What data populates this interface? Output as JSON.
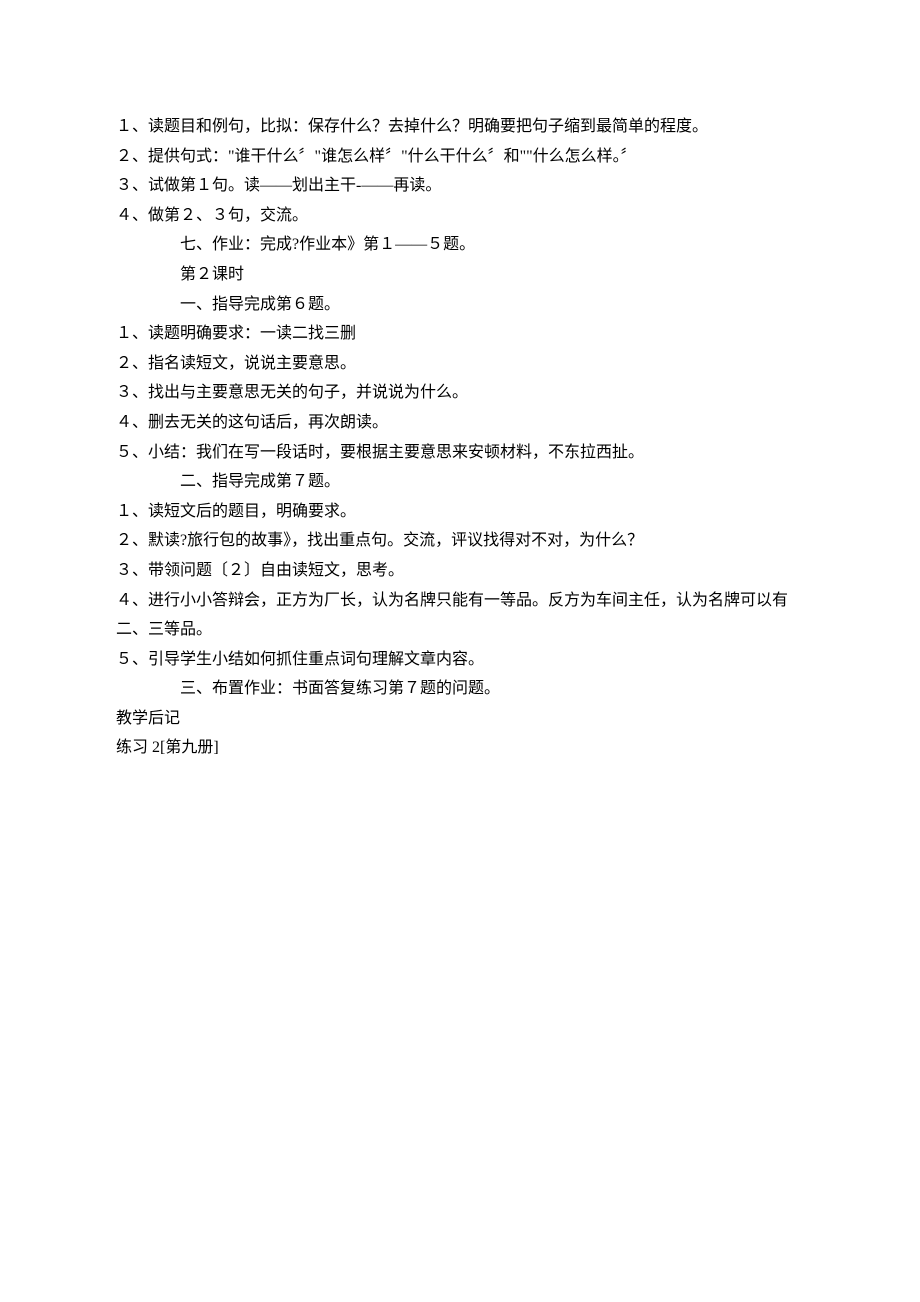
{
  "lines": [
    {
      "text": "１、读题目和例句，比拟：保存什么？去掉什么？明确要把句子缩到最简单的程度。",
      "indent": 0
    },
    {
      "text": "２、提供句式：\"谁干什么〞\"谁怎么样〞\"什么干什么〞和\"\"什么怎么样。〞",
      "indent": 0
    },
    {
      "text": "３、试做第１句。读——划出主干-——再读。",
      "indent": 0
    },
    {
      "text": "４、做第２、３句，交流。",
      "indent": 0
    },
    {
      "text": "七、作业：完成?作业本》第１——５题。",
      "indent": 1
    },
    {
      "text": "第２课时",
      "indent": 1
    },
    {
      "text": "一、指导完成第６题。",
      "indent": 1
    },
    {
      "text": "１、读题明确要求：一读二找三删",
      "indent": 0
    },
    {
      "text": "２、指名读短文，说说主要意思。",
      "indent": 0
    },
    {
      "text": "３、找出与主要意思无关的句子，并说说为什么。",
      "indent": 0
    },
    {
      "text": "４、删去无关的这句话后，再次朗读。",
      "indent": 0
    },
    {
      "text": "５、小结：我们在写一段话时，要根据主要意思来安顿材料，不东拉西扯。",
      "indent": 0
    },
    {
      "text": "二、指导完成第７题。",
      "indent": 1
    },
    {
      "text": "１、读短文后的题目，明确要求。",
      "indent": 0
    },
    {
      "text": "２、默读?旅行包的故事》，找出重点句。交流，评议找得对不对，为什么？",
      "indent": 0
    },
    {
      "text": "３、带领问题〔２〕自由读短文，思考。",
      "indent": 0
    },
    {
      "text": "４、进行小小答辩会，正方为厂长，认为名牌只能有一等品。反方为车间主任，认为名牌可以有二、三等品。",
      "indent": 0
    },
    {
      "text": "５、引导学生小结如何抓住重点词句理解文章内容。",
      "indent": 0
    },
    {
      "text": "三、布置作业：书面答复练习第７题的问题。",
      "indent": 1
    },
    {
      "text": "教学后记",
      "indent": 0
    },
    {
      "text": "练习 2[第九册]",
      "indent": 0
    }
  ]
}
